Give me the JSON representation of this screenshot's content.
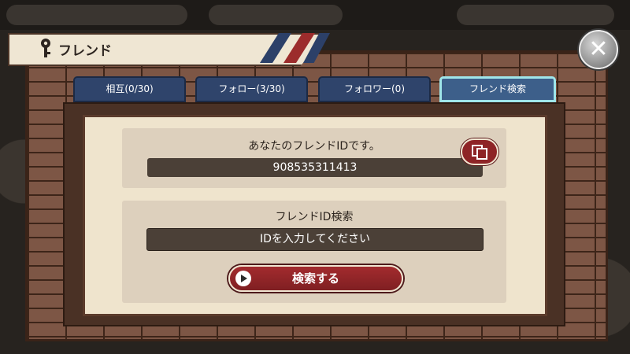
{
  "dialog": {
    "title": "フレンド"
  },
  "tabs": [
    {
      "label": "相互(0/30)",
      "active": false
    },
    {
      "label": "フォロー(3/30)",
      "active": false
    },
    {
      "label": "フォロワー(0)",
      "active": false
    },
    {
      "label": "フレンド検索",
      "active": true
    }
  ],
  "my_id": {
    "label": "あなたのフレンドIDです。",
    "value": "908535311413"
  },
  "search": {
    "label": "フレンドID検索",
    "placeholder": "IDを入力してください",
    "button_label": "検索する"
  },
  "colors": {
    "accent_red": "#8e2426",
    "tab_blue": "#2f446b",
    "active_tab_border": "#9fe6ea",
    "panel_bg": "#efe4cd"
  },
  "icons": {
    "close": "close-icon",
    "key": "key-icon",
    "copy": "copy-icon",
    "play": "play-icon"
  }
}
